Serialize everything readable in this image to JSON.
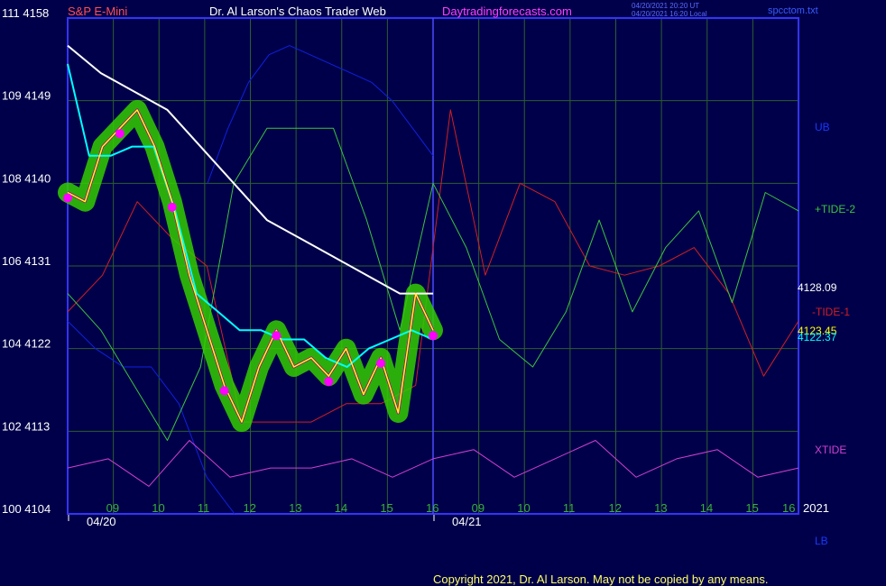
{
  "header": {
    "instrument": "S&P E-Mini",
    "site": "Dr. Al Larson's Chaos Trader Web",
    "url": "Daytradingforecasts.com",
    "stamp1": "04/20/2021 20:20 UT",
    "stamp2": "04/20/2021 16:20 Local",
    "file": "spcctom.txt"
  },
  "footer": {
    "copyright": "Copyright 2021, Dr. Al Larson. May not be copied by any means."
  },
  "colors": {
    "background": "#00004a",
    "grid": "#2d5e2d",
    "frame": "#3333ff",
    "price": "#ff00ff",
    "ema_fast": "#ffff00",
    "ema_slow": "#00ffff",
    "ema_long": "#ffffff",
    "tide2": "#3cc43c",
    "tide1": "#d02020",
    "xtide": "#d040d0",
    "bands": "#1020e0",
    "glow": "#33cc00"
  },
  "chart_data": {
    "type": "line",
    "title": "S&P E-Mini",
    "x_ticks": [
      "09",
      "10",
      "11",
      "12",
      "13",
      "14",
      "15",
      "16",
      "09",
      "10",
      "11",
      "12",
      "13",
      "14",
      "15",
      "16"
    ],
    "x_dates": [
      "04/20",
      "04/21"
    ],
    "year": "2021",
    "y_ticks": [
      {
        "left": "111",
        "right": "4158"
      },
      {
        "left": "109",
        "right": "4149"
      },
      {
        "left": "108",
        "right": "4140"
      },
      {
        "left": "106",
        "right": "4131"
      },
      {
        "left": "104",
        "right": "4122"
      },
      {
        "left": "102",
        "right": "4113"
      },
      {
        "left": "100",
        "right": "4104"
      }
    ],
    "ylim": [
      4104,
      4158
    ],
    "grid": true,
    "series": [
      {
        "name": "UB",
        "values": [
          4140,
          4146,
          4151,
          4154,
          4155,
          4154,
          4153,
          4152,
          4151,
          4149,
          4146,
          4143
        ]
      },
      {
        "name": "+TIDE-2",
        "values": [
          4128,
          4124,
          4118,
          4112,
          4120,
          4140,
          4146,
          4146,
          4146,
          4136,
          4124,
          4140,
          4133,
          4123,
          4120,
          4126,
          4136,
          4126,
          4133,
          4137,
          4127,
          4139,
          4137
        ]
      },
      {
        "name": "-TIDE-1",
        "values": [
          4126,
          4130,
          4138,
          4134,
          4131,
          4114,
          4114,
          4114,
          4116,
          4116,
          4118,
          4148,
          4130,
          4140,
          4138,
          4131,
          4130,
          4131,
          4133,
          4128,
          4119,
          4125
        ]
      },
      {
        "name": "XTIDE",
        "values": [
          4109,
          4110,
          4107,
          4112,
          4108,
          4109,
          4109,
          4110,
          4108,
          4110,
          4111,
          4108,
          4110,
          4112,
          4108,
          4110,
          4111,
          4108,
          4109
        ]
      },
      {
        "name": "LB",
        "values": [
          4125,
          4122,
          4120,
          4120,
          4116,
          4108,
          4104
        ]
      },
      {
        "name": "price",
        "values": [
          4139,
          4138,
          4144,
          4146,
          4148,
          4144,
          4138,
          4130,
          4124,
          4118,
          4114,
          4120,
          4124,
          4120,
          4121,
          4119,
          4122,
          4117,
          4121,
          4115,
          4128,
          4124
        ]
      },
      {
        "name": "ema_slow",
        "values": [
          4153,
          4143,
          4143,
          4144,
          4144,
          4137,
          4128,
          4126,
          4124,
          4124,
          4123,
          4123,
          4121,
          4120,
          4122,
          4123,
          4124,
          4123
        ]
      },
      {
        "name": "ema_long",
        "values": [
          4155,
          4152,
          4150,
          4148,
          4144,
          4140,
          4136,
          4134,
          4132,
          4130,
          4128,
          4128
        ]
      }
    ],
    "right_labels": [
      {
        "text": "UB",
        "color": "#1838ff"
      },
      {
        "text": "+TIDE-2",
        "color": "#3cc43c"
      },
      {
        "text": "4128.09",
        "color": "#ffffff"
      },
      {
        "text": "-TIDE-1",
        "color": "#d02020"
      },
      {
        "text": "4123.45",
        "color": "#ffff00"
      },
      {
        "text": "4122.37",
        "color": "#00ffff"
      },
      {
        "text": "XTIDE",
        "color": "#d040d0"
      },
      {
        "text": "LB",
        "color": "#1838ff"
      }
    ]
  }
}
